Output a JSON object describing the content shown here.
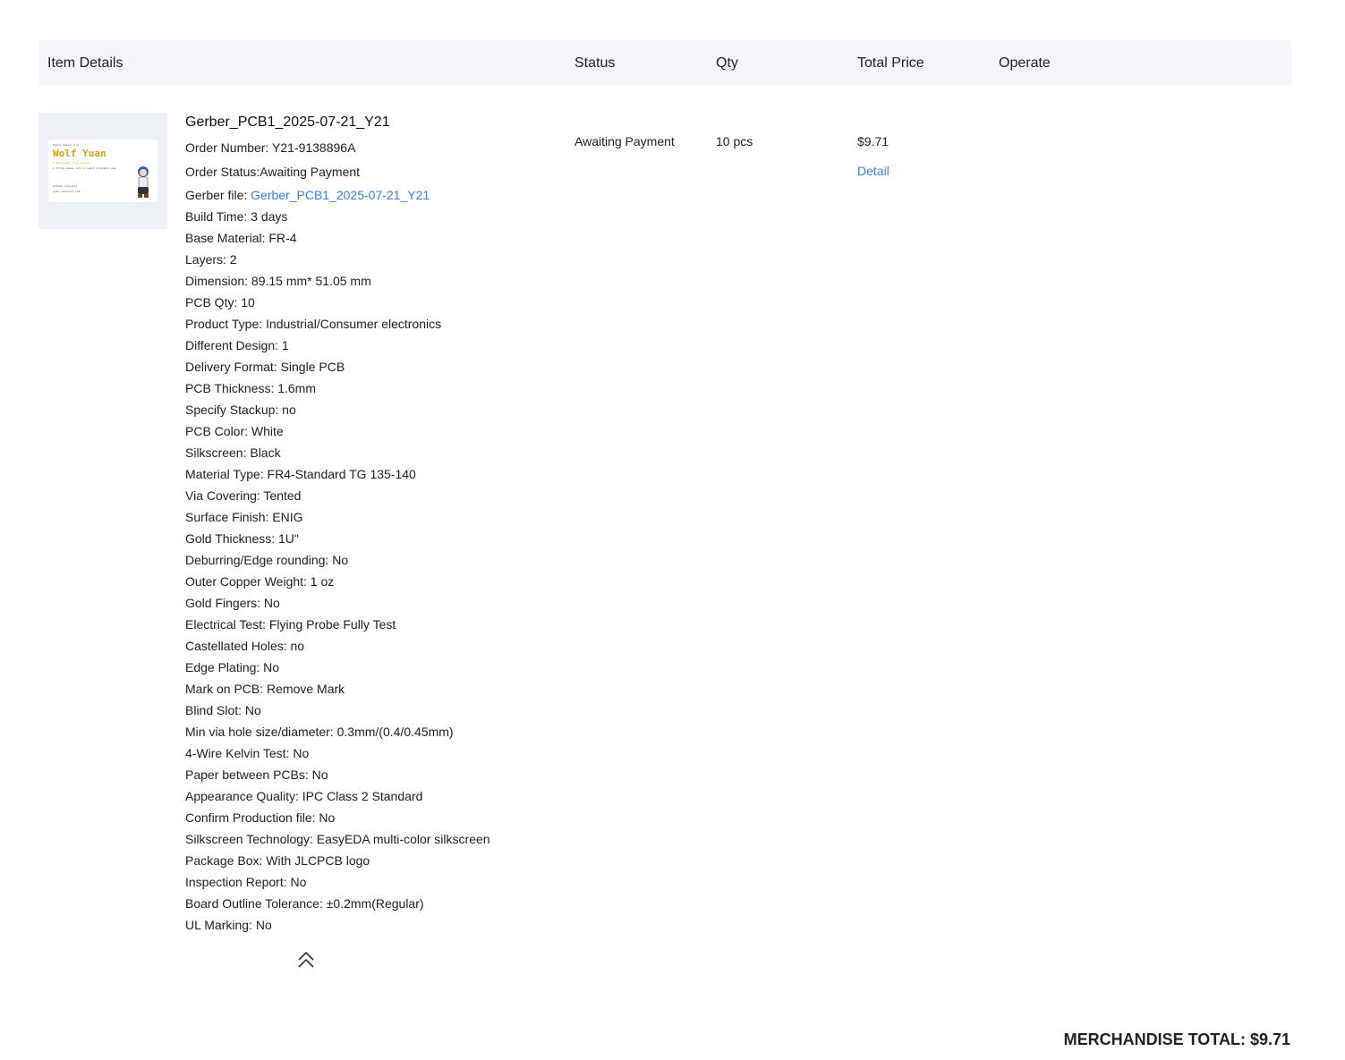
{
  "table_header": {
    "item_details": "Item Details",
    "status": "Status",
    "qty": "Qty",
    "total_price": "Total Price",
    "operate": "Operate"
  },
  "thumbnail": {
    "logo_text": "Wolf Yuan",
    "small_lines": [
      "Hello there! I'm",
      "A Developer From Taiwan",
      "I bring ideas into a smart & modern way",
      "github.com/wolf",
      "yuan.com/wolf.com"
    ]
  },
  "item": {
    "title": "Gerber_PCB1_2025-07-21_Y21",
    "order_number": "Order Number: Y21-9138896A",
    "order_status": "Order Status:Awaiting Payment",
    "gerber_label": "Gerber file: ",
    "gerber_link": "Gerber_PCB1_2025-07-21_Y21",
    "specs": [
      "Build Time: 3 days",
      "Base Material: FR-4",
      "Layers: 2",
      "Dimension: 89.15 mm* 51.05 mm",
      "PCB Qty: 10",
      "Product Type: Industrial/Consumer electronics",
      "Different Design: 1",
      "Delivery Format: Single PCB",
      "PCB Thickness: 1.6mm",
      "Specify Stackup: no",
      "PCB Color: White",
      "Silkscreen: Black",
      "Material Type: FR4-Standard TG 135-140",
      "Via Covering: Tented",
      "Surface Finish: ENIG",
      "Gold Thickness: 1U\"",
      "Deburring/Edge rounding: No",
      "Outer Copper Weight: 1 oz",
      "Gold Fingers: No",
      "Electrical Test: Flying Probe Fully Test",
      "Castellated Holes: no",
      "Edge Plating: No",
      "Mark on PCB: Remove Mark",
      "Blind Slot: No",
      "Min via hole size/diameter: 0.3mm/(0.4/0.45mm)",
      "4-Wire Kelvin Test: No",
      "Paper between PCBs: No",
      "Appearance Quality: IPC Class 2 Standard",
      "Confirm Production file: No",
      "Silkscreen Technology: EasyEDA multi-color silkscreen",
      "Package Box: With JLCPCB logo",
      "Inspection Report: No",
      "Board Outline Tolerance: ±0.2mm(Regular)",
      "UL Marking: No"
    ],
    "status": "Awaiting Payment",
    "qty": "10 pcs",
    "total_price": "$9.71",
    "detail_link": "Detail",
    "collapse_icon": "double-chevron-up-icon"
  },
  "merchandise_total": "MERCHANDISE TOTAL: $9.71",
  "colors": {
    "link": "#3b82d6",
    "header_bg": "#f4f6fa",
    "thumb_bg": "#edf0f4",
    "logo": "#d4a017"
  }
}
